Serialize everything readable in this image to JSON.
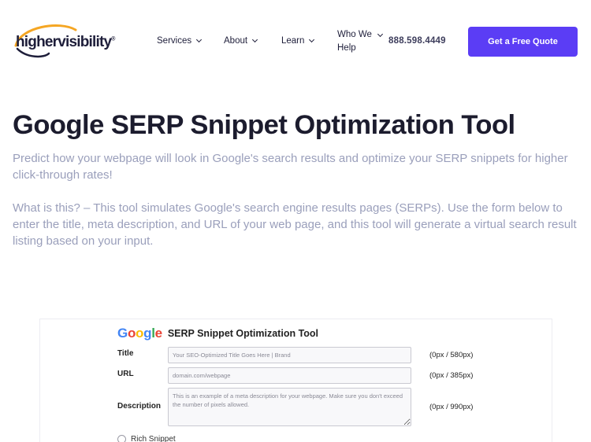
{
  "header": {
    "logo_text": "highervisibility",
    "logo_reg": "®",
    "nav": {
      "services": "Services",
      "about": "About",
      "learn": "Learn",
      "who_we_help": "Who We Help"
    },
    "phone": "888.598.4449",
    "cta": "Get a Free Quote"
  },
  "main": {
    "title": "Google SERP Snippet Optimization Tool",
    "intro": "Predict how your webpage will look in Google's search results and optimize your SERP snippets for higher click-through rates!",
    "description": "What is this? – This tool simulates Google's search engine results pages (SERPs). Use the form below to enter the title, meta description, and URL of your web page, and this tool will generate a virtual search result listing based on your input."
  },
  "tool": {
    "brand": [
      "G",
      "o",
      "o",
      "g",
      "l",
      "e"
    ],
    "brand_colors": [
      "#4285F4",
      "#EA4335",
      "#FBBC05",
      "#4285F4",
      "#34A853",
      "#EA4335"
    ],
    "title": "SERP Snippet Optimization Tool",
    "fields": {
      "title": {
        "label": "Title",
        "placeholder": "Your SEO-Optimized Title Goes Here | Brand",
        "value": "",
        "counter": "(0px / 580px)"
      },
      "url": {
        "label": "URL",
        "placeholder": "domain.com/webpage",
        "value": "",
        "counter": "(0px / 385px)"
      },
      "description": {
        "label": "Description",
        "placeholder": "This is an example of a meta description for your webpage. Make sure you don't exceed the number of pixels allowed.",
        "value": "",
        "counter": "(0px / 990px)"
      }
    },
    "rich_snippet_label": "Rich Snippet"
  },
  "colors": {
    "accent": "#5b3df5",
    "logo_orange": "#f5a623",
    "muted_text": "#9a9fbb"
  }
}
